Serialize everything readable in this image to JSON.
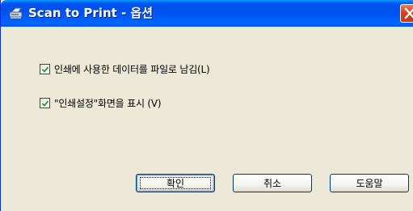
{
  "window": {
    "title": "Scan to Print - 옵션",
    "icon": "scanner-app-icon",
    "close_icon": "close-icon"
  },
  "options": [
    {
      "label": "인쇄에 사용한 데이터를 파일로 남김(L)",
      "checked": true
    },
    {
      "label": "\"인쇄설정\"화면을 표시 (V)",
      "checked": true
    }
  ],
  "buttons": {
    "ok_label": "확인",
    "cancel_label": "취소",
    "help_label": "도움말"
  },
  "colors": {
    "titlebar": "#0054e3",
    "dialog_bg": "#ece9d8",
    "close_button": "#d6411f",
    "checkmark": "#21a121"
  }
}
